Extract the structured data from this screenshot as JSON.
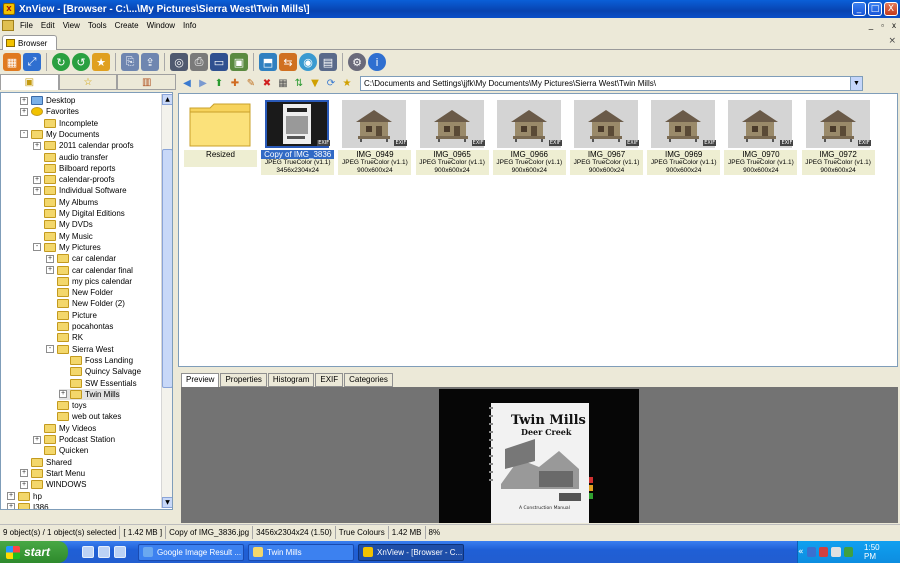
{
  "window": {
    "title": "XnView - [Browser - C:\\...\\My Pictures\\Sierra West\\Twin Mills\\]",
    "min_label": "_",
    "max_label": "□",
    "close_label": "X"
  },
  "menu": {
    "items": [
      "File",
      "Edit",
      "View",
      "Tools",
      "Create",
      "Window",
      "Info"
    ],
    "doc_min": "_",
    "doc_max": "▫",
    "doc_close": "x"
  },
  "tabs": {
    "browser_label": "Browser",
    "close_label": "×"
  },
  "address": {
    "path": "C:\\Documents and Settings\\jjfk\\My Documents\\My Pictures\\Sierra West\\Twin Mills\\"
  },
  "tree": {
    "nodes": [
      {
        "label": "Desktop",
        "expander": "+"
      },
      {
        "label": "Favorites",
        "expander": "+"
      },
      {
        "label": "Incomplete",
        "expander": ""
      },
      {
        "label": "My Documents",
        "expander": "-"
      },
      {
        "label": "2011 calendar proofs",
        "expander": "+"
      },
      {
        "label": "audio transfer",
        "expander": ""
      },
      {
        "label": "Bilboard reports",
        "expander": ""
      },
      {
        "label": "calendar-proofs",
        "expander": "+"
      },
      {
        "label": "Individual Software",
        "expander": "+"
      },
      {
        "label": "My Albums",
        "expander": ""
      },
      {
        "label": "My Digital Editions",
        "expander": ""
      },
      {
        "label": "My DVDs",
        "expander": ""
      },
      {
        "label": "My Music",
        "expander": ""
      },
      {
        "label": "My Pictures",
        "expander": "-"
      },
      {
        "label": "car calendar",
        "expander": "+"
      },
      {
        "label": "car calendar final",
        "expander": "+"
      },
      {
        "label": "my pics calendar",
        "expander": ""
      },
      {
        "label": "New Folder",
        "expander": ""
      },
      {
        "label": "New Folder (2)",
        "expander": ""
      },
      {
        "label": "Picture",
        "expander": ""
      },
      {
        "label": "pocahontas",
        "expander": ""
      },
      {
        "label": "RK",
        "expander": ""
      },
      {
        "label": "Sierra West",
        "expander": "-"
      },
      {
        "label": "Foss Landing",
        "expander": ""
      },
      {
        "label": "Quincy Salvage",
        "expander": ""
      },
      {
        "label": "SW Essentials",
        "expander": ""
      },
      {
        "label": "Twin Mills",
        "expander": "+"
      },
      {
        "label": "toys",
        "expander": ""
      },
      {
        "label": "web out takes",
        "expander": ""
      },
      {
        "label": "My Videos",
        "expander": ""
      },
      {
        "label": "Podcast Station",
        "expander": "+"
      },
      {
        "label": "Quicken",
        "expander": ""
      },
      {
        "label": "Shared",
        "expander": ""
      },
      {
        "label": "Start Menu",
        "expander": "+"
      },
      {
        "label": "WINDOWS",
        "expander": "+"
      },
      {
        "label": "hp",
        "expander": "+"
      },
      {
        "label": "I386",
        "expander": "+"
      },
      {
        "label": "",
        "expander": "+"
      }
    ]
  },
  "thumbnails": [
    {
      "name": "Resized",
      "info": "",
      "size": "",
      "kind": "folder"
    },
    {
      "name": "Copy of IMG_3836",
      "info": "JPEG TrueColor (v1.1)",
      "size": "3456x2304x24",
      "kind": "book"
    },
    {
      "name": "IMG_0949",
      "info": "JPEG TrueColor (v1.1)",
      "size": "900x600x24",
      "kind": "hut"
    },
    {
      "name": "IMG_0965",
      "info": "JPEG TrueColor (v1.1)",
      "size": "900x600x24",
      "kind": "hut"
    },
    {
      "name": "IMG_0966",
      "info": "JPEG TrueColor (v1.1)",
      "size": "900x600x24",
      "kind": "hut"
    },
    {
      "name": "IMG_0967",
      "info": "JPEG TrueColor (v1.1)",
      "size": "900x600x24",
      "kind": "hut"
    },
    {
      "name": "IMG_0969",
      "info": "JPEG TrueColor (v1.1)",
      "size": "900x600x24",
      "kind": "hut"
    },
    {
      "name": "IMG_0970",
      "info": "JPEG TrueColor (v1.1)",
      "size": "900x600x24",
      "kind": "hut"
    },
    {
      "name": "IMG_0972",
      "info": "JPEG TrueColor (v1.1)",
      "size": "900x600x24",
      "kind": "hut"
    }
  ],
  "exif_badge": "EXIF",
  "preview_tabs": [
    "Preview",
    "Properties",
    "Histogram",
    "EXIF",
    "Categories"
  ],
  "preview_book": {
    "title_line1": "Twin Mills",
    "title_line2": "Deer Creek",
    "subtitle": "A Construction Manual"
  },
  "status": {
    "objects": "9 object(s) / 1 object(s) selected",
    "selected_size": "[ 1.42 MB ]",
    "filename": "Copy of IMG_3836.jpg",
    "dimensions": "3456x2304x24 (1.50)",
    "colours": "True Colours",
    "size": "1.42 MB",
    "zoom": "8%"
  },
  "taskbar": {
    "start": "start",
    "tasks": [
      "Google Image Result ...",
      "Twin Mills",
      "XnView - [Browser - C..."
    ],
    "clock": "1:50 PM"
  }
}
